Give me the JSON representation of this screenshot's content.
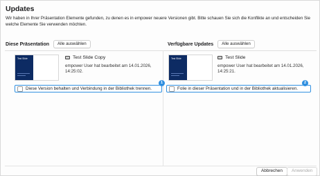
{
  "dialog": {
    "title": "Updates",
    "description": "Wir haben in Ihrer Präsentation Elemente gefunden, zu denen es in empower neuere Versionen gibt. Bitte schauen Sie sich die Konflikte an und entscheiden Sie welche Elemente Sie verwenden möchten."
  },
  "left": {
    "heading": "Diese Präsentation",
    "select_all": "Alle auswählen",
    "slide": {
      "thumb_title": "Test Slide",
      "name": "Test Slide Copy",
      "meta_line1": "empower User hat bearbeitet am 14.01.2026,",
      "meta_line2": "14:25:02."
    },
    "option_label": "Diese Version behalten und Verbindung in der Bibliothek trennen.",
    "badge": "1"
  },
  "right": {
    "heading": "Verfügbare Updates",
    "select_all": "Alle auswählen",
    "slide": {
      "thumb_title": "Test Slide",
      "name": "Test Slide",
      "meta_line1": "empower User hat bearbeitet am 14.01.2026,",
      "meta_line2": "14:25:21."
    },
    "option_label": "Folie in dieser Präsentation und in der Bibliothek aktualisieren.",
    "badge": "2"
  },
  "footer": {
    "cancel": "Abbrechen",
    "apply": "Anwenden"
  },
  "colors": {
    "accent": "#2f8fe0",
    "slide_dark": "#0d2b63"
  }
}
